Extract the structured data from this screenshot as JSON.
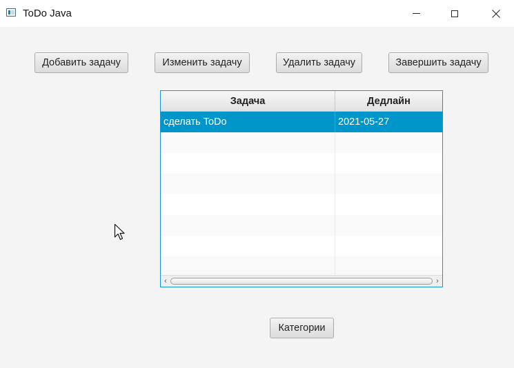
{
  "window": {
    "title": "ToDo Java",
    "icon": "app-window-icon",
    "controls": {
      "minimize": "minimize-icon",
      "maximize": "maximize-icon",
      "close": "close-icon"
    }
  },
  "toolbar": {
    "add_label": "Добавить задачу",
    "edit_label": "Изменить задачу",
    "delete_label": "Удалить задачу",
    "complete_label": "Завершить задачу"
  },
  "table": {
    "columns": [
      "Задача",
      "Дедлайн"
    ],
    "rows": [
      {
        "task": "сделать ToDo",
        "deadline": "2021-05-27",
        "selected": true
      }
    ],
    "empty_rows_visible": 7,
    "selection_color": "#0096c9",
    "border_color": "#0e97d4"
  },
  "footer": {
    "categories_label": "Категории"
  }
}
